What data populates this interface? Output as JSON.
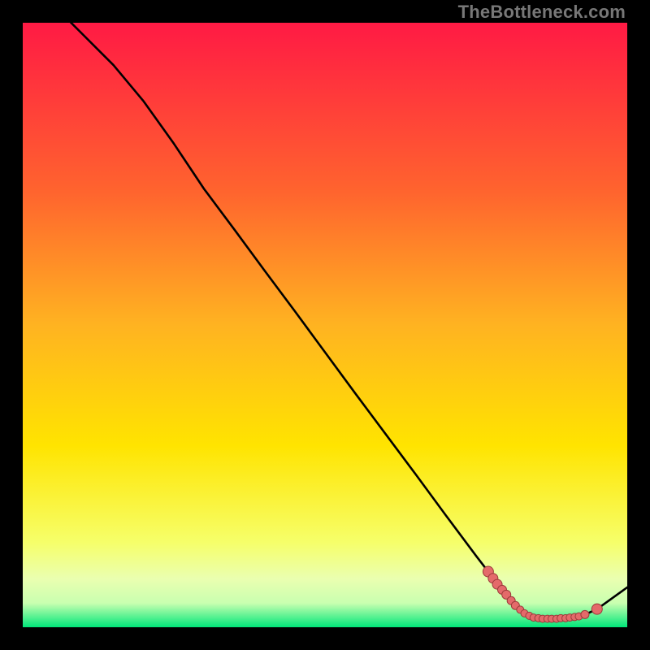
{
  "attribution": "TheBottleneck.com",
  "colors": {
    "bg": "#000000",
    "grad_top": "#ff1a44",
    "grad_mid1": "#ff9a2a",
    "grad_mid2": "#ffe400",
    "grad_low1": "#f6ff6a",
    "grad_low2": "#c9ffb0",
    "grad_bottom": "#00e77a",
    "line": "#000000",
    "dot_fill": "#e46a6a",
    "dot_stroke": "#9b3a3a"
  },
  "chart_data": {
    "type": "line",
    "xlabel": "",
    "ylabel": "",
    "xlim": [
      0,
      100
    ],
    "ylim": [
      0,
      100
    ],
    "grid": false,
    "legend": false,
    "series": [
      {
        "name": "curve",
        "x": [
          0,
          5,
          10,
          15,
          20,
          25,
          27,
          30,
          35,
          40,
          45,
          50,
          55,
          60,
          65,
          70,
          75,
          77,
          80,
          82,
          84,
          86,
          88,
          90,
          92,
          93,
          95,
          100
        ],
        "y": [
          108,
          103,
          98,
          93,
          87,
          80,
          77,
          72.5,
          65.8,
          59,
          52.3,
          45.5,
          38.7,
          32,
          25.3,
          18.5,
          11.8,
          9.2,
          5.4,
          3.0,
          1.8,
          1.4,
          1.4,
          1.5,
          1.8,
          2.1,
          3.0,
          6.6
        ]
      }
    ],
    "markers": [
      {
        "x": 77.0,
        "y": 9.2,
        "r": 6.5
      },
      {
        "x": 77.8,
        "y": 8.1,
        "r": 6.0
      },
      {
        "x": 78.5,
        "y": 7.1,
        "r": 6.0
      },
      {
        "x": 79.3,
        "y": 6.2,
        "r": 5.5
      },
      {
        "x": 80.0,
        "y": 5.4,
        "r": 5.5
      },
      {
        "x": 80.8,
        "y": 4.4,
        "r": 5.0
      },
      {
        "x": 81.5,
        "y": 3.6,
        "r": 5.0
      },
      {
        "x": 82.3,
        "y": 2.9,
        "r": 4.5
      },
      {
        "x": 83.0,
        "y": 2.3,
        "r": 4.5
      },
      {
        "x": 83.8,
        "y": 1.9,
        "r": 4.5
      },
      {
        "x": 84.5,
        "y": 1.6,
        "r": 4.5
      },
      {
        "x": 85.3,
        "y": 1.5,
        "r": 4.5
      },
      {
        "x": 86.0,
        "y": 1.4,
        "r": 4.5
      },
      {
        "x": 86.8,
        "y": 1.4,
        "r": 4.5
      },
      {
        "x": 87.5,
        "y": 1.4,
        "r": 4.5
      },
      {
        "x": 88.3,
        "y": 1.4,
        "r": 4.5
      },
      {
        "x": 89.0,
        "y": 1.5,
        "r": 4.5
      },
      {
        "x": 89.8,
        "y": 1.5,
        "r": 4.5
      },
      {
        "x": 90.5,
        "y": 1.6,
        "r": 4.5
      },
      {
        "x": 91.3,
        "y": 1.7,
        "r": 4.5
      },
      {
        "x": 92.0,
        "y": 1.8,
        "r": 4.5
      },
      {
        "x": 93.0,
        "y": 2.1,
        "r": 5.0
      },
      {
        "x": 95.0,
        "y": 3.0,
        "r": 6.5
      }
    ]
  }
}
